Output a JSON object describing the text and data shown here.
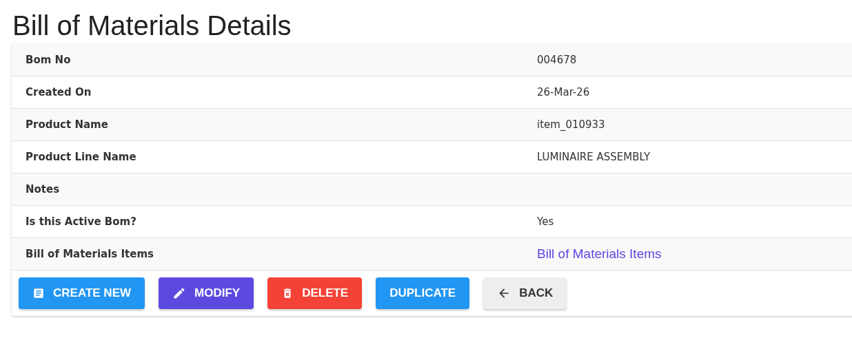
{
  "title": "Bill of Materials Details",
  "rows": [
    {
      "label": "Bom No",
      "value": "004678",
      "kind": "text"
    },
    {
      "label": "Created On",
      "value": "26-Mar-26",
      "kind": "text"
    },
    {
      "label": "Product Name",
      "value": "item_010933",
      "kind": "text"
    },
    {
      "label": "Product Line Name",
      "value": "LUMINAIRE ASSEMBLY",
      "kind": "text"
    },
    {
      "label": "Notes"
    },
    {
      "label": "Is this Active Bom?",
      "value": "Yes",
      "kind": "text"
    },
    {
      "label": "Bill of Materials Items",
      "value": "Bill of Materials Items",
      "kind": "link"
    }
  ],
  "buttons": [
    {
      "label": "CREATE NEW",
      "kind": "create"
    },
    {
      "label": "MODIFY",
      "kind": "modify"
    },
    {
      "label": "DELETE",
      "kind": "delete"
    },
    {
      "label": "DUPLICATE",
      "kind": "duplicate"
    },
    {
      "label": "BACK",
      "kind": "back"
    }
  ]
}
